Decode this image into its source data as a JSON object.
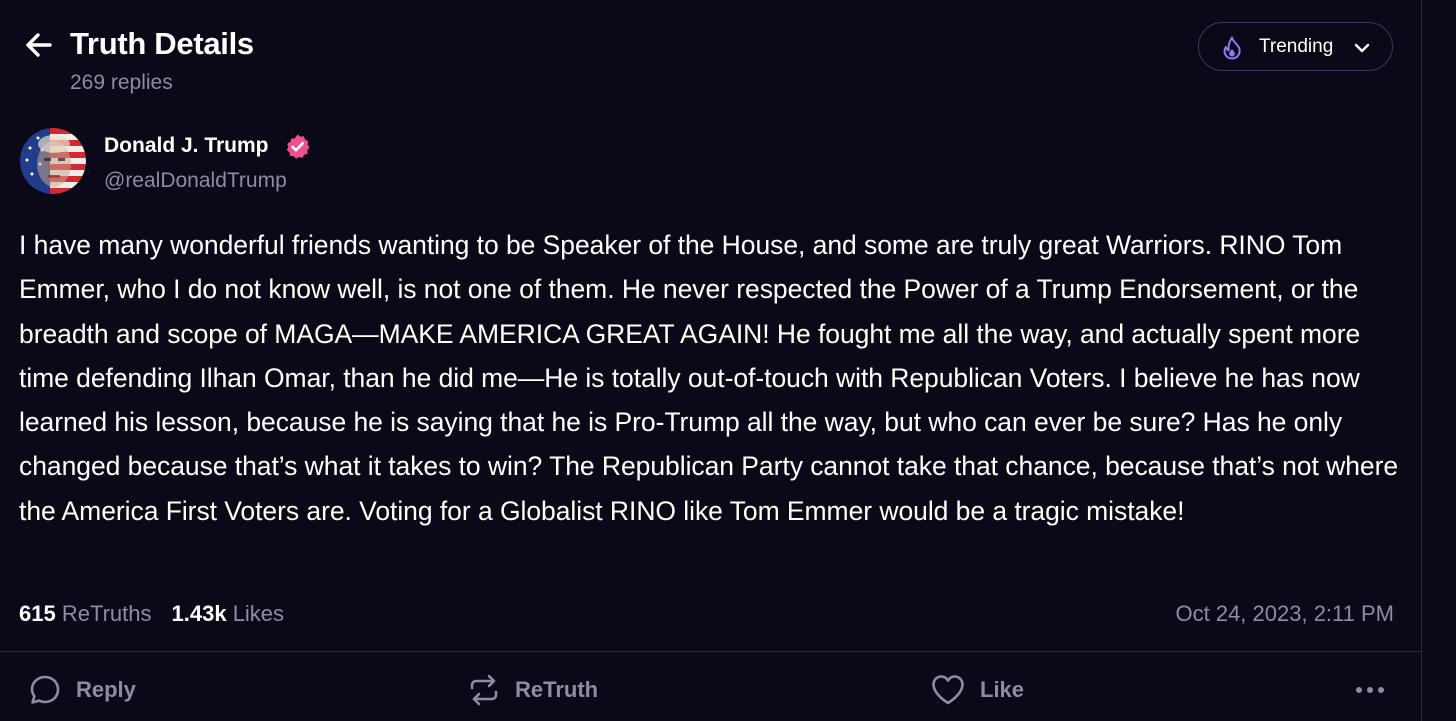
{
  "header": {
    "title": "Truth Details",
    "replies": "269 replies"
  },
  "sort": {
    "label": "Trending"
  },
  "post": {
    "author": {
      "name": "Donald J. Trump",
      "handle": "@realDonaldTrump"
    },
    "body": "I have many wonderful friends wanting to be Speaker of the House, and some are truly great Warriors. RINO Tom Emmer, who I do not know well, is not one of them. He never respected the Power of a Trump Endorsement, or the breadth and scope of MAGA—MAKE AMERICA GREAT AGAIN! He fought me all the way, and actually spent more time defending Ilhan Omar, than he did me—He is totally out-of-touch with Republican Voters. I believe he has now learned his lesson, because he is saying that he is Pro-Trump all the way, but who can ever be sure? Has he only changed because that’s what it takes to win? The Republican Party cannot take that chance, because that’s not where the America First Voters are. Voting for a Globalist RINO like Tom Emmer would be a tragic mistake!",
    "stats": {
      "retruths_count": "615",
      "retruths_label": "ReTruths",
      "likes_count": "1.43k",
      "likes_label": "Likes"
    },
    "timestamp": "Oct 24, 2023, 2:11 PM"
  },
  "actions": {
    "reply": "Reply",
    "retruth": "ReTruth",
    "like": "Like"
  },
  "icons": {
    "back": "arrow-left-icon",
    "sort": "flame-icon",
    "chevron": "chevron-down-icon",
    "verified": "verified-badge-icon",
    "reply": "speech-bubble-icon",
    "retruth": "repost-icon",
    "like": "heart-icon",
    "more": "more-dots-icon"
  },
  "colors": {
    "background": "#0b0917",
    "muted_text": "#8e8ba3",
    "accent": "#8a7df5",
    "verified": "#f0508c",
    "border": "#2a2740"
  }
}
